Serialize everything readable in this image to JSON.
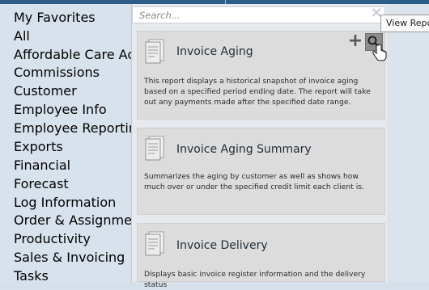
{
  "sidebar": {
    "items": [
      {
        "label": "My Favorites"
      },
      {
        "label": "All"
      },
      {
        "label": "Affordable Care Act"
      },
      {
        "label": "Commissions"
      },
      {
        "label": "Customer"
      },
      {
        "label": "Employee Info"
      },
      {
        "label": "Employee Reporting"
      },
      {
        "label": "Exports"
      },
      {
        "label": "Financial"
      },
      {
        "label": "Forecast"
      },
      {
        "label": "Log Information"
      },
      {
        "label": "Order & Assignment"
      },
      {
        "label": "Productivity"
      },
      {
        "label": "Sales & Invoicing"
      },
      {
        "label": "Tasks"
      }
    ],
    "active": "Sales & Invoicing"
  },
  "search": {
    "placeholder": "Search..."
  },
  "tooltip": {
    "text": "View Report"
  },
  "reports": [
    {
      "title": "Invoice Aging",
      "description": "This report displays a historical snapshot of invoice aging based on a specified period ending date.  The report will take out any payments made after the specified date range."
    },
    {
      "title": "Invoice Aging Summary",
      "description": "Summarizes the aging by customer as well as shows how much over or under the specified credit limit each client is."
    },
    {
      "title": "Invoice Delivery",
      "description": "Displays basic invoice register information and the delivery status"
    }
  ],
  "icons": {
    "add": "plus-icon",
    "view": "magnifier-icon",
    "report": "report-document-icon",
    "close": "close-icon"
  }
}
